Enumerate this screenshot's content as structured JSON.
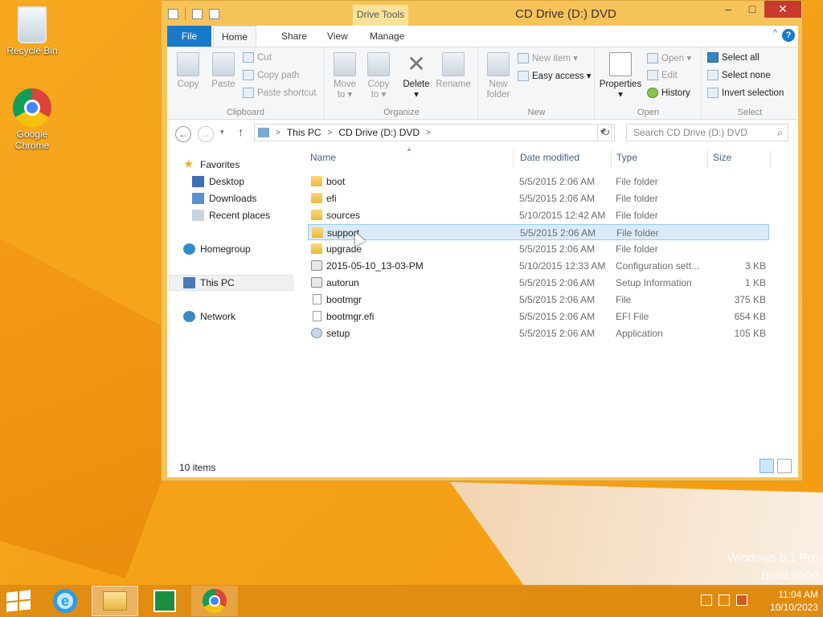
{
  "desktop": {
    "icons": [
      {
        "label": "Recycle Bin"
      },
      {
        "label": "Google Chrome"
      }
    ],
    "watermark_line1": "Windows 8.1 Pro",
    "watermark_line2": "Build 9600"
  },
  "window": {
    "title": "CD Drive (D:) DVD",
    "context_tab": "Drive Tools",
    "controls": {
      "minimize": "–",
      "maximize": "□",
      "close": "✕"
    },
    "tabs": [
      "File",
      "Home",
      "Share",
      "View",
      "Manage"
    ],
    "ribbon": {
      "clipboard": {
        "label": "Clipboard",
        "copy": "Copy",
        "paste": "Paste",
        "cut": "Cut",
        "copy_path": "Copy path",
        "paste_shortcut": "Paste shortcut"
      },
      "organize": {
        "label": "Organize",
        "move_to_1": "Move",
        "move_to_2": "to ▾",
        "copy_to_1": "Copy",
        "copy_to_2": "to ▾",
        "delete": "Delete",
        "delete_arrow": "▾",
        "rename": "Rename"
      },
      "new": {
        "label": "New",
        "new_folder_1": "New",
        "new_folder_2": "folder",
        "new_item": "New item ▾",
        "easy_access": "Easy access ▾"
      },
      "open": {
        "label": "Open",
        "properties": "Properties",
        "properties_arrow": "▾",
        "open": "Open ▾",
        "edit": "Edit",
        "history": "History"
      },
      "select": {
        "label": "Select",
        "select_all": "Select all",
        "select_none": "Select none",
        "invert_selection": "Invert selection"
      }
    },
    "address": {
      "back": "←",
      "forward": "→",
      "recent": "▾",
      "up": "↑",
      "crumbs": [
        "This PC",
        "CD Drive (D:) DVD"
      ],
      "refresh": "↻",
      "search_placeholder": "Search CD Drive (D:) DVD"
    },
    "nav_pane": {
      "favorites": "Favorites",
      "desktop": "Desktop",
      "downloads": "Downloads",
      "recent_places": "Recent places",
      "homegroup": "Homegroup",
      "this_pc": "This PC",
      "network": "Network"
    },
    "columns": {
      "name": "Name",
      "date": "Date modified",
      "type": "Type",
      "size": "Size"
    },
    "files": [
      {
        "name": "boot",
        "date": "5/5/2015 2:06 AM",
        "type": "File folder",
        "size": "",
        "icon": "folder"
      },
      {
        "name": "efi",
        "date": "5/5/2015 2:06 AM",
        "type": "File folder",
        "size": "",
        "icon": "folder"
      },
      {
        "name": "sources",
        "date": "5/10/2015 12:42 AM",
        "type": "File folder",
        "size": "",
        "icon": "folder"
      },
      {
        "name": "support",
        "date": "5/5/2015 2:06 AM",
        "type": "File folder",
        "size": "",
        "icon": "folder",
        "selected": true
      },
      {
        "name": "upgrade",
        "date": "5/5/2015 2:06 AM",
        "type": "File folder",
        "size": "",
        "icon": "folder"
      },
      {
        "name": "2015-05-10_13-03-PM",
        "date": "5/10/2015 12:33 AM",
        "type": "Configuration sett...",
        "size": "3 KB",
        "icon": "cfg"
      },
      {
        "name": "autorun",
        "date": "5/5/2015 2:06 AM",
        "type": "Setup Information",
        "size": "1 KB",
        "icon": "cfg"
      },
      {
        "name": "bootmgr",
        "date": "5/5/2015 2:06 AM",
        "type": "File",
        "size": "375 KB",
        "icon": "file"
      },
      {
        "name": "bootmgr.efi",
        "date": "5/5/2015 2:06 AM",
        "type": "EFI File",
        "size": "654 KB",
        "icon": "file"
      },
      {
        "name": "setup",
        "date": "5/5/2015 2:06 AM",
        "type": "Application",
        "size": "105 KB",
        "icon": "app"
      }
    ],
    "status": "10 items"
  },
  "taskbar": {
    "clock_time": "11:04 AM",
    "clock_date": "10/10/2023"
  }
}
